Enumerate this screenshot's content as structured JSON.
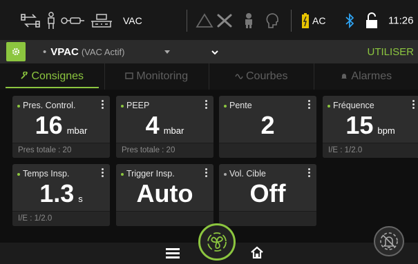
{
  "status": {
    "mode_text": "VAC",
    "power_text": "AC",
    "time": "11:26",
    "icons": [
      "network-icon",
      "patient-icon",
      "circuit-icon",
      "humidifier-icon",
      "warning-icon",
      "tools-icon",
      "nurse-icon",
      "head-icon",
      "battery-icon",
      "bluetooth-icon",
      "unlock-icon"
    ]
  },
  "modebar": {
    "mode": "VPAC",
    "mode_sub": "(VAC Actif)",
    "use_label": "UTILISER"
  },
  "tabs": [
    {
      "label": "Consignes",
      "icon": "wrench-icon",
      "active": true
    },
    {
      "label": "Monitoring",
      "icon": "monitor-icon",
      "active": false
    },
    {
      "label": "Courbes",
      "icon": "wave-icon",
      "active": false
    },
    {
      "label": "Alarmes",
      "icon": "bell-icon",
      "active": false
    }
  ],
  "cards": [
    {
      "label": "Pres. Control.",
      "value": "16",
      "unit": "mbar",
      "foot": "Pres totale : 20"
    },
    {
      "label": "PEEP",
      "value": "4",
      "unit": "mbar",
      "foot": "Pres totale : 20"
    },
    {
      "label": "Pente",
      "value": "2",
      "unit": "",
      "foot": ""
    },
    {
      "label": "Fréquence",
      "value": "15",
      "unit": "bpm",
      "foot": "I/E : 1/2.0"
    },
    {
      "label": "Temps Insp.",
      "value": "1.3",
      "unit": "s",
      "foot": "I/E : 1/2.0"
    },
    {
      "label": "Trigger Insp.",
      "value": "Auto",
      "unit": "",
      "foot": ""
    },
    {
      "label": "Vol. Cible",
      "value": "Off",
      "unit": "",
      "foot": ""
    }
  ],
  "colors": {
    "accent": "#8cc63f",
    "background": "#111111",
    "card": "#2d2d2d"
  }
}
